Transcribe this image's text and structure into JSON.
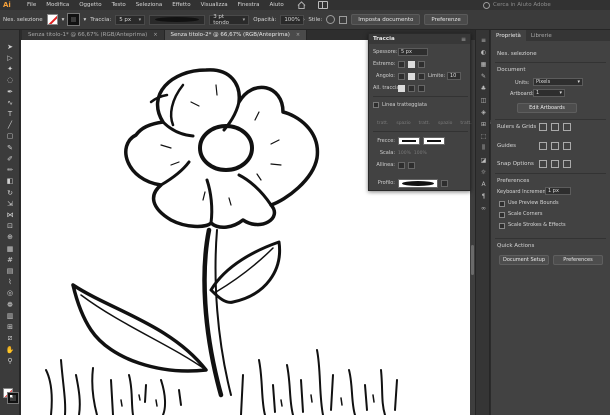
{
  "menubar": {
    "logo": "Ai",
    "items": [
      "File",
      "Modifica",
      "Oggetto",
      "Testo",
      "Seleziona",
      "Effetto",
      "Visualizza",
      "Finestra",
      "Aiuto"
    ],
    "search_placeholder": "Cerca in Aiuto Adobe"
  },
  "controlbar": {
    "selection_label": "Nes. selezione",
    "stroke_label": "Traccia:",
    "stroke_weight": "5 px",
    "brush_label": "3 pt tondo",
    "opacity_label": "Opacità:",
    "opacity_value": "100%",
    "style_label": "Stile:",
    "doc_setup_button": "Imposta documento",
    "preferences_button": "Preferenze"
  },
  "tabs": [
    {
      "label": "Senza titolo-1* @ 66,67% (RGB/Anteprima)",
      "close": "×",
      "active": false
    },
    {
      "label": "Senza titolo-2* @ 66,67% (RGB/Anteprima)",
      "close": "×",
      "active": true
    }
  ],
  "stroke_panel": {
    "title": "Traccia",
    "menu": "≡",
    "weight_label": "Spessore:",
    "weight_value": "5 px",
    "cap_label": "Estremo:",
    "corner_label": "Angolo:",
    "limit_label": "Limite:",
    "limit_value": "10",
    "align_label": "All. traccia:",
    "dashed_label": "Linea tratteggiata",
    "dash_fields": [
      "tratt.",
      "spazio",
      "tratt.",
      "spazio",
      "tratt.",
      "spazio"
    ],
    "arrows_label": "Frecce:",
    "scale_label": "Scala:",
    "scale_values": [
      "100%",
      "100%"
    ],
    "align_arrows_label": "Allinea:",
    "profile_label": "Profilo:"
  },
  "properties": {
    "tabs": [
      "Proprietà",
      "Librerie"
    ],
    "no_selection": "Nes. selezione",
    "document_header": "Document",
    "units_label": "Units:",
    "units_value": "Pixels",
    "artboard_label": "Artboard:",
    "artboard_value": "1",
    "edit_artboards_button": "Edit Artboards",
    "rulers_label": "Rulers & Grids",
    "guides_label": "Guides",
    "snap_label": "Snap Options",
    "preferences_header": "Preferences",
    "keyboard_increment_label": "Keyboard Increment:",
    "keyboard_increment_value": "1 px",
    "use_preview_bounds": "Use Preview Bounds",
    "scale_corners": "Scale Corners",
    "scale_strokes": "Scale Strokes & Effects",
    "quick_actions_header": "Quick Actions",
    "doc_setup_button": "Document Setup",
    "preferences_button": "Preferences"
  },
  "colors": {
    "ui_dark": "#323232",
    "panel": "#424242",
    "accent_logo": "#f7a23b",
    "none_swatch_red": "#e02020",
    "artwork_stroke": "#111111"
  },
  "toolbar_icons": [
    "selection-arrow-icon",
    "direct-selection-icon",
    "magic-wand-icon",
    "lasso-icon",
    "pen-icon",
    "curvature-icon",
    "type-icon",
    "line-icon",
    "rectangle-icon",
    "paintbrush-icon",
    "shaper-icon",
    "pencil-icon",
    "eraser-icon",
    "rotate-icon",
    "scale-icon",
    "width-icon",
    "free-transform-icon",
    "shape-builder-icon",
    "perspective-icon",
    "mesh-icon",
    "gradient-icon",
    "eyedropper-icon",
    "blend-icon",
    "symbol-sprayer-icon",
    "graph-icon",
    "artboard-icon",
    "slice-icon",
    "hand-icon",
    "zoom-icon"
  ]
}
